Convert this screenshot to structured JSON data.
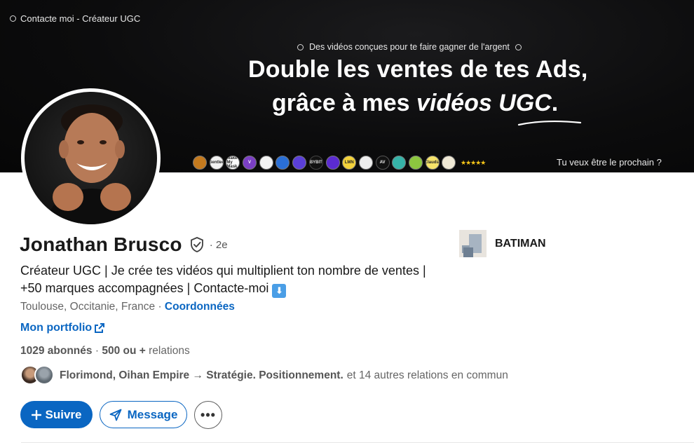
{
  "banner": {
    "corner_text": "Contacte moi - Créateur UGC",
    "tagline": "Des vidéos conçues pour te faire gagner de l'argent",
    "headline_line1": "Double les ventes de tes Ads,",
    "headline_line2_prefix": "grâce à mes ",
    "headline_line2_italic": "vidéos UGC",
    "headline_line2_suffix": ".",
    "brand_logos": [
      "",
      "Gentlee",
      "Make My Mask",
      "V",
      "",
      "",
      "",
      "BYBIT",
      "",
      "LMN",
      "",
      "AV",
      "",
      "",
      "Claudia",
      ""
    ],
    "stars": "★★★★★",
    "cta": "Tu veux être le prochain ?"
  },
  "profile": {
    "name": "Jonathan Brusco",
    "degree": "· 2e",
    "headline": "Créateur UGC | Je crée tes vidéos qui multiplient ton nombre de ventes | +50 marques accompagnées | Contacte-moi",
    "headline_emoji": "⬇",
    "location": "Toulouse, Occitanie, France",
    "location_sep": "·",
    "contact_link": "Coordonnées",
    "portfolio_link": "Mon portfolio",
    "followers": "1029 abonnés",
    "followers_sep": "·",
    "connections": "500 ou +",
    "connections_suffix": "relations",
    "mutual_names": "Florimond, Oihan Empire → Stratégie. Positionnement.",
    "mutual_suffix": "et 14 autres relations en commun"
  },
  "company": {
    "name": "BATIMAN"
  },
  "actions": {
    "follow_label": "Suivre",
    "message_label": "Message",
    "more_label": "•••"
  },
  "colors": {
    "brand_blue": "#0a66c2",
    "banner_bg": "#0c0c0d"
  }
}
